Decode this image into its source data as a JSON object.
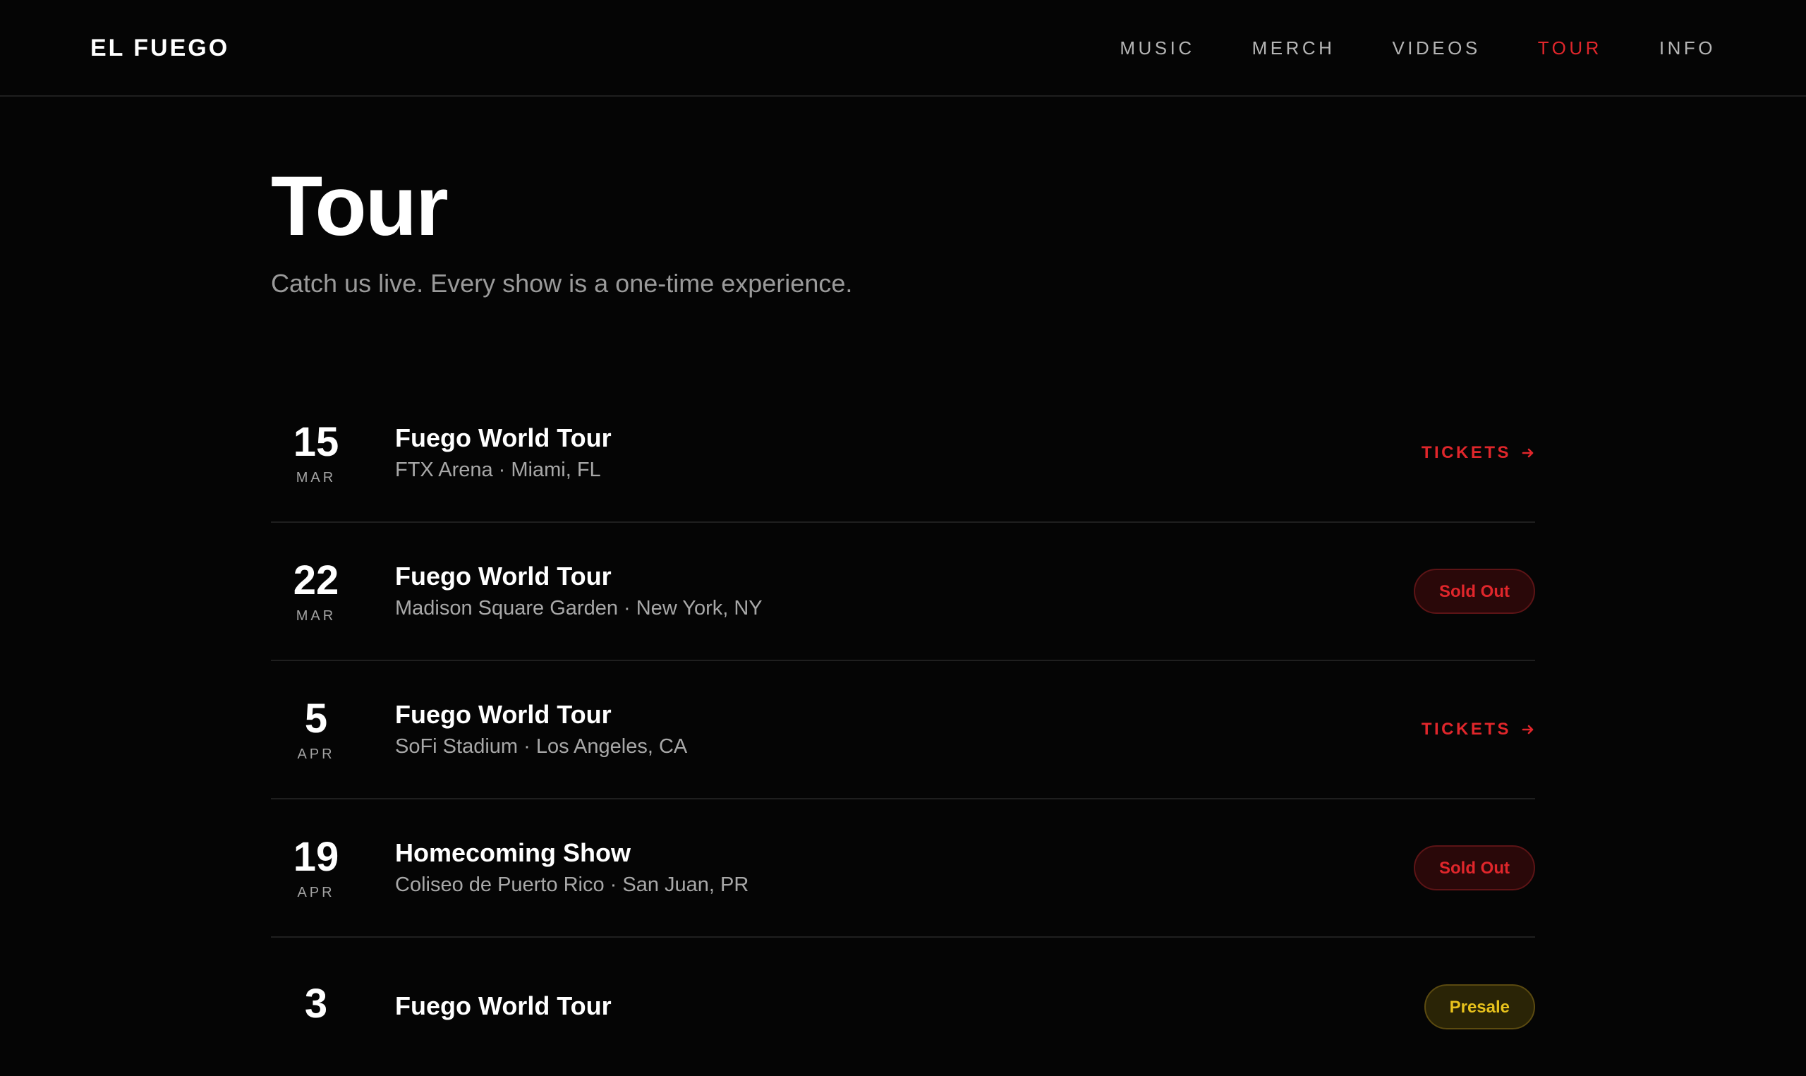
{
  "header": {
    "logo": "EL FUEGO",
    "nav": [
      {
        "label": "MUSIC"
      },
      {
        "label": "MERCH"
      },
      {
        "label": "VIDEOS"
      },
      {
        "label": "TOUR"
      },
      {
        "label": "INFO"
      }
    ],
    "active_nav": "TOUR"
  },
  "page": {
    "title": "Tour",
    "subtitle": "Catch us live. Every show is a one-time experience."
  },
  "shows": [
    {
      "day": "15",
      "month": "MAR",
      "title": "Fuego World Tour",
      "venue": "FTX Arena · Miami, FL",
      "action": "TICKETS",
      "action_type": "tickets"
    },
    {
      "day": "22",
      "month": "MAR",
      "title": "Fuego World Tour",
      "venue": "Madison Square Garden · New York, NY",
      "action": "Sold Out",
      "action_type": "sold"
    },
    {
      "day": "5",
      "month": "APR",
      "title": "Fuego World Tour",
      "venue": "SoFi Stadium · Los Angeles, CA",
      "action": "TICKETS",
      "action_type": "tickets"
    },
    {
      "day": "19",
      "month": "APR",
      "title": "Homecoming Show",
      "venue": "Coliseo de Puerto Rico · San Juan, PR",
      "action": "Sold Out",
      "action_type": "sold"
    },
    {
      "day": "3",
      "month": "",
      "title": "Fuego World Tour",
      "venue": "",
      "action": "Presale",
      "action_type": "presale"
    }
  ],
  "colors": {
    "background": "#050505",
    "accent": "#e0262b",
    "presale": "#e8c21c",
    "muted_text": "#a8a8a8"
  },
  "icons": {
    "tickets_arrow": "arrow-right-icon"
  }
}
